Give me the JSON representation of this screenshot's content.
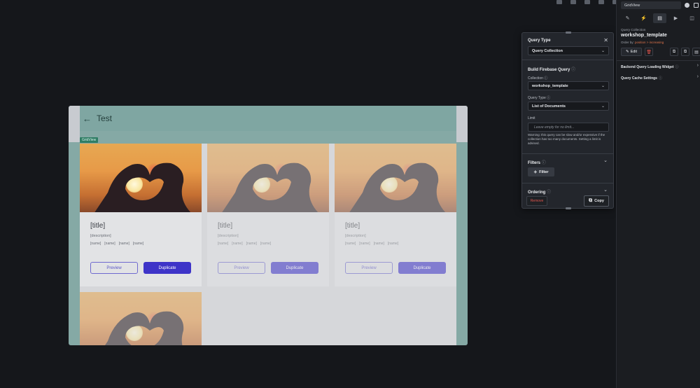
{
  "app": {
    "title": "Test",
    "gridview_tag": "GridView"
  },
  "cards": [
    {
      "title": "[title]",
      "description": "[description]",
      "names": [
        "[name]",
        "[name]",
        "[name]",
        "[name]"
      ],
      "preview_label": "Preview",
      "duplicate_label": "Duplicate"
    },
    {
      "title": "[title]",
      "description": "[description]",
      "names": [
        "[name]",
        "[name]",
        "[name]",
        "[name]"
      ],
      "preview_label": "Preview",
      "duplicate_label": "Duplicate"
    },
    {
      "title": "[title]",
      "description": "[description]",
      "names": [
        "[name]",
        "[name]",
        "[name]",
        "[name]"
      ],
      "preview_label": "Preview",
      "duplicate_label": "Duplicate"
    }
  ],
  "popup": {
    "header": "Query Type",
    "query_type_value": "Query Collection",
    "build_title": "Build Firebase Query",
    "collection_label": "Collection",
    "collection_value": "workshop_template",
    "query_type_label": "Query Type",
    "query_type_select": "List of Documents",
    "limit_label": "Limit",
    "limit_placeholder": "Leave empty for no limit...",
    "warning": "Warning: this query can be slow and/or expensive if the collection has too many documents. Setting a limit is advised.",
    "filters_label": "Filters",
    "filter_button": "Filter",
    "ordering_label": "Ordering",
    "remove_label": "Remove",
    "copy_label": "Copy"
  },
  "panel": {
    "search_value": "GridView",
    "query_collection_label": "Query Collection",
    "collection_name": "workshop_template",
    "order_prefix": "Order by:",
    "order_value": "position > increasing",
    "edit_label": "Edit",
    "backend_query_label": "Backend Query Loading Widget",
    "cache_label": "Query Cache Settings"
  },
  "colors": {
    "accent": "#3e34c8",
    "danger": "#e0544c",
    "order_highlight": "#e0744b",
    "frame": "#85a9a5"
  }
}
